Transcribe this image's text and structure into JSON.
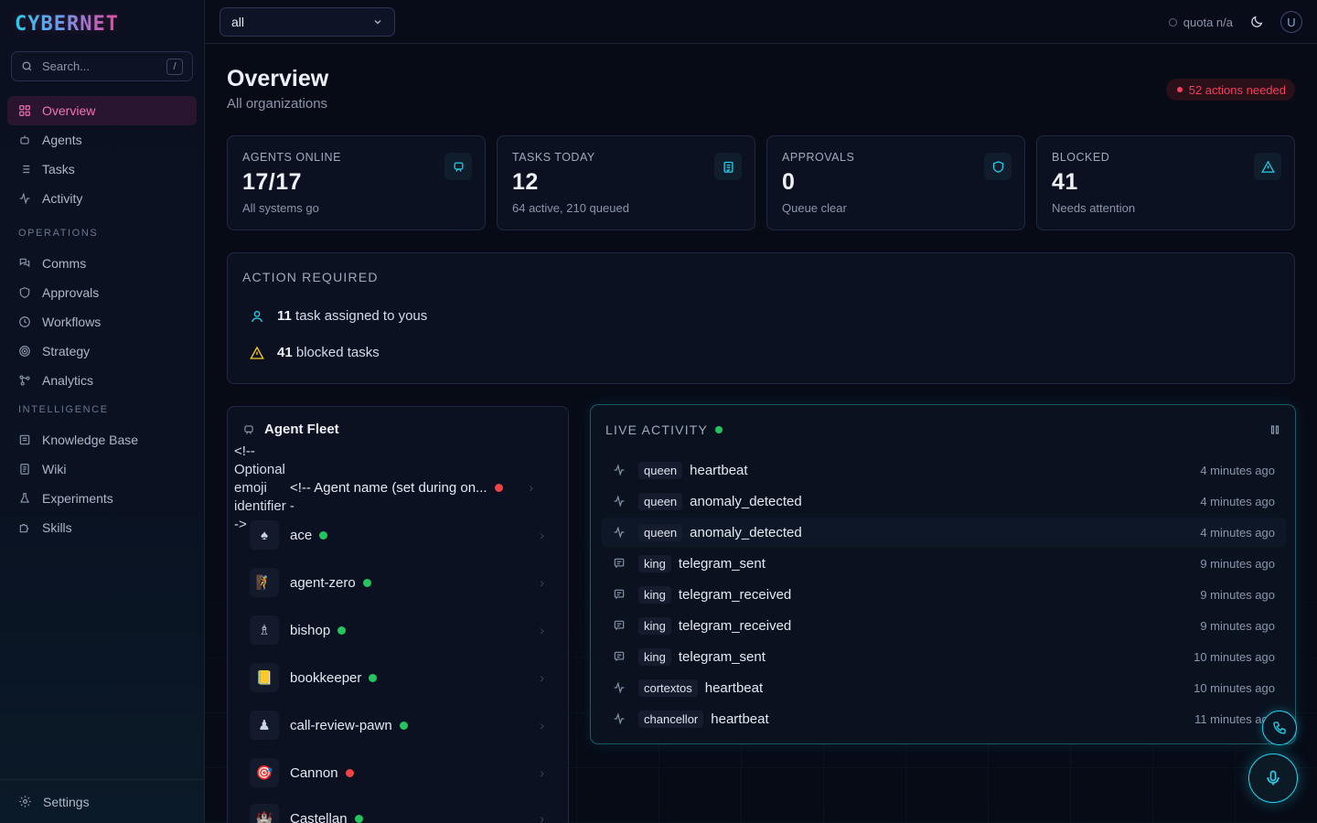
{
  "app": {
    "logo": "CYBERNET"
  },
  "sidebar": {
    "search_placeholder": "Search...",
    "search_shortcut": "/",
    "primary": [
      {
        "label": "Overview",
        "icon": "grid-icon",
        "active": true
      },
      {
        "label": "Agents",
        "icon": "bot-icon"
      },
      {
        "label": "Tasks",
        "icon": "list-icon"
      },
      {
        "label": "Activity",
        "icon": "pulse-icon"
      }
    ],
    "operations_label": "OPERATIONS",
    "operations": [
      {
        "label": "Comms",
        "icon": "comms-icon"
      },
      {
        "label": "Approvals",
        "icon": "shield-icon"
      },
      {
        "label": "Workflows",
        "icon": "clock-icon"
      },
      {
        "label": "Strategy",
        "icon": "target-icon"
      },
      {
        "label": "Analytics",
        "icon": "nodes-icon"
      }
    ],
    "intelligence_label": "INTELLIGENCE",
    "intelligence": [
      {
        "label": "Knowledge Base",
        "icon": "book-icon"
      },
      {
        "label": "Wiki",
        "icon": "doc-icon"
      },
      {
        "label": "Experiments",
        "icon": "flask-icon"
      },
      {
        "label": "Skills",
        "icon": "puzzle-icon"
      }
    ],
    "settings_label": "Settings"
  },
  "topbar": {
    "org_select": "all",
    "quota": "quota n/a",
    "user_initial": "U"
  },
  "page": {
    "title": "Overview",
    "subtitle": "All organizations",
    "alert_badge": "52 actions needed"
  },
  "stats": [
    {
      "label": "AGENTS ONLINE",
      "value": "17/17",
      "sub": "All systems go",
      "icon": "bot-icon"
    },
    {
      "label": "TASKS TODAY",
      "value": "12",
      "sub": "64 active, 210 queued",
      "icon": "clipboard-icon"
    },
    {
      "label": "APPROVALS",
      "value": "0",
      "sub": "Queue clear",
      "icon": "shield-icon"
    },
    {
      "label": "BLOCKED",
      "value": "41",
      "sub": "Needs attention",
      "icon": "warning-icon"
    }
  ],
  "action_required": {
    "title": "ACTION REQUIRED",
    "items": [
      {
        "count": "11",
        "text": " task assigned to yous",
        "icon": "user-icon"
      },
      {
        "count": "41",
        "text": " blocked tasks",
        "icon": "warning-icon"
      }
    ]
  },
  "fleet": {
    "title": "Agent Fleet",
    "raw_comment": "<!-- Optional emoji identifier -->",
    "header_row_name": "<!-- Agent name (set during on...",
    "agents": [
      {
        "emoji": "♠",
        "name": "ace",
        "status": "online"
      },
      {
        "emoji": "🧗",
        "name": "agent-zero",
        "status": "online"
      },
      {
        "emoji": "♗",
        "name": "bishop",
        "status": "online"
      },
      {
        "emoji": "📒",
        "name": "bookkeeper",
        "status": "online"
      },
      {
        "emoji": "♟",
        "name": "call-review-pawn",
        "status": "online"
      },
      {
        "emoji": "🎯",
        "name": "Cannon",
        "status": "offline"
      },
      {
        "emoji": "🏰",
        "name": "Castellan",
        "status": "online"
      }
    ]
  },
  "live": {
    "title": "LIVE ACTIVITY",
    "events": [
      {
        "icon": "pulse-icon",
        "who": "queen",
        "what": "heartbeat",
        "when": "4 minutes ago"
      },
      {
        "icon": "pulse-icon",
        "who": "queen",
        "what": "anomaly_detected",
        "when": "4 minutes ago"
      },
      {
        "icon": "pulse-icon",
        "who": "queen",
        "what": "anomaly_detected",
        "when": "4 minutes ago"
      },
      {
        "icon": "message-icon",
        "who": "king",
        "what": "telegram_sent",
        "when": "9 minutes ago"
      },
      {
        "icon": "message-icon",
        "who": "king",
        "what": "telegram_received",
        "when": "9 minutes ago"
      },
      {
        "icon": "message-icon",
        "who": "king",
        "what": "telegram_received",
        "when": "9 minutes ago"
      },
      {
        "icon": "message-icon",
        "who": "king",
        "what": "telegram_sent",
        "when": "10 minutes ago"
      },
      {
        "icon": "pulse-icon",
        "who": "cortextos",
        "what": "heartbeat",
        "when": "10 minutes ago"
      },
      {
        "icon": "pulse-icon",
        "who": "chancellor",
        "what": "heartbeat",
        "when": "11 minutes ago"
      }
    ]
  },
  "colors": {
    "accent_cyan": "#22d3ee",
    "accent_pink": "#f472b6",
    "online": "#22c55e",
    "offline": "#ef4444",
    "warning": "#facc15"
  }
}
